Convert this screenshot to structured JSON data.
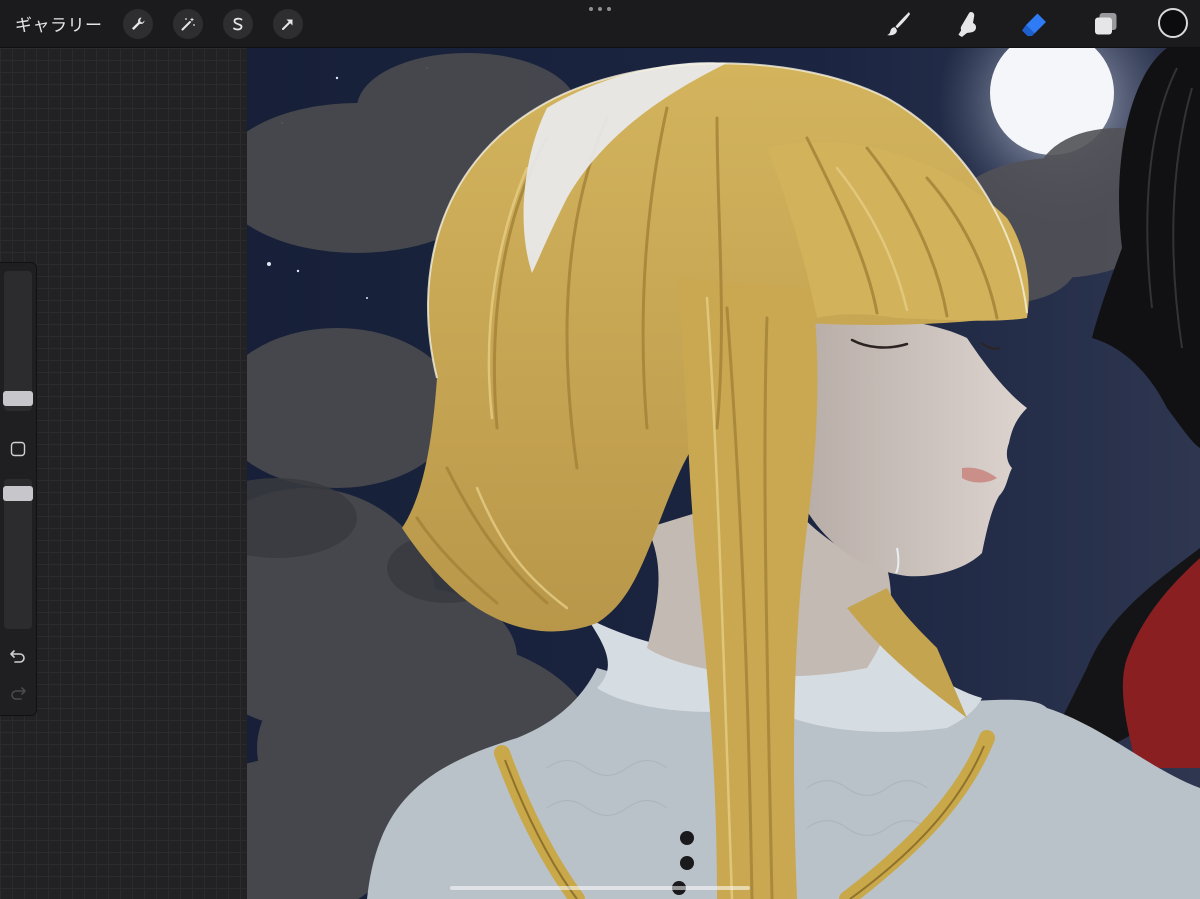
{
  "toolbar": {
    "gallery_label": "ギャラリー",
    "left_tools": [
      "wrench-icon",
      "magic-wand-icon",
      "selection-icon",
      "transform-arrow-icon"
    ],
    "right_tools": [
      "brush-icon",
      "smudge-icon",
      "eraser-icon",
      "layers-icon"
    ],
    "active_tool": "eraser",
    "active_color": "#0c0c0e",
    "accent": "#2f7bf6"
  },
  "sidebar": {
    "brush_size_level": 0.05,
    "opacity_level": 0.95,
    "icons": [
      "modify-square-icon",
      "undo-icon",
      "redo-icon"
    ]
  },
  "canvas": {
    "subject": "illustration",
    "colors": {
      "sky": "#1b2440",
      "hair": "#c8a64f",
      "skin": "#d2c7c2",
      "blouse": "#b9c2c9",
      "necklace": "#c9a84a"
    }
  }
}
